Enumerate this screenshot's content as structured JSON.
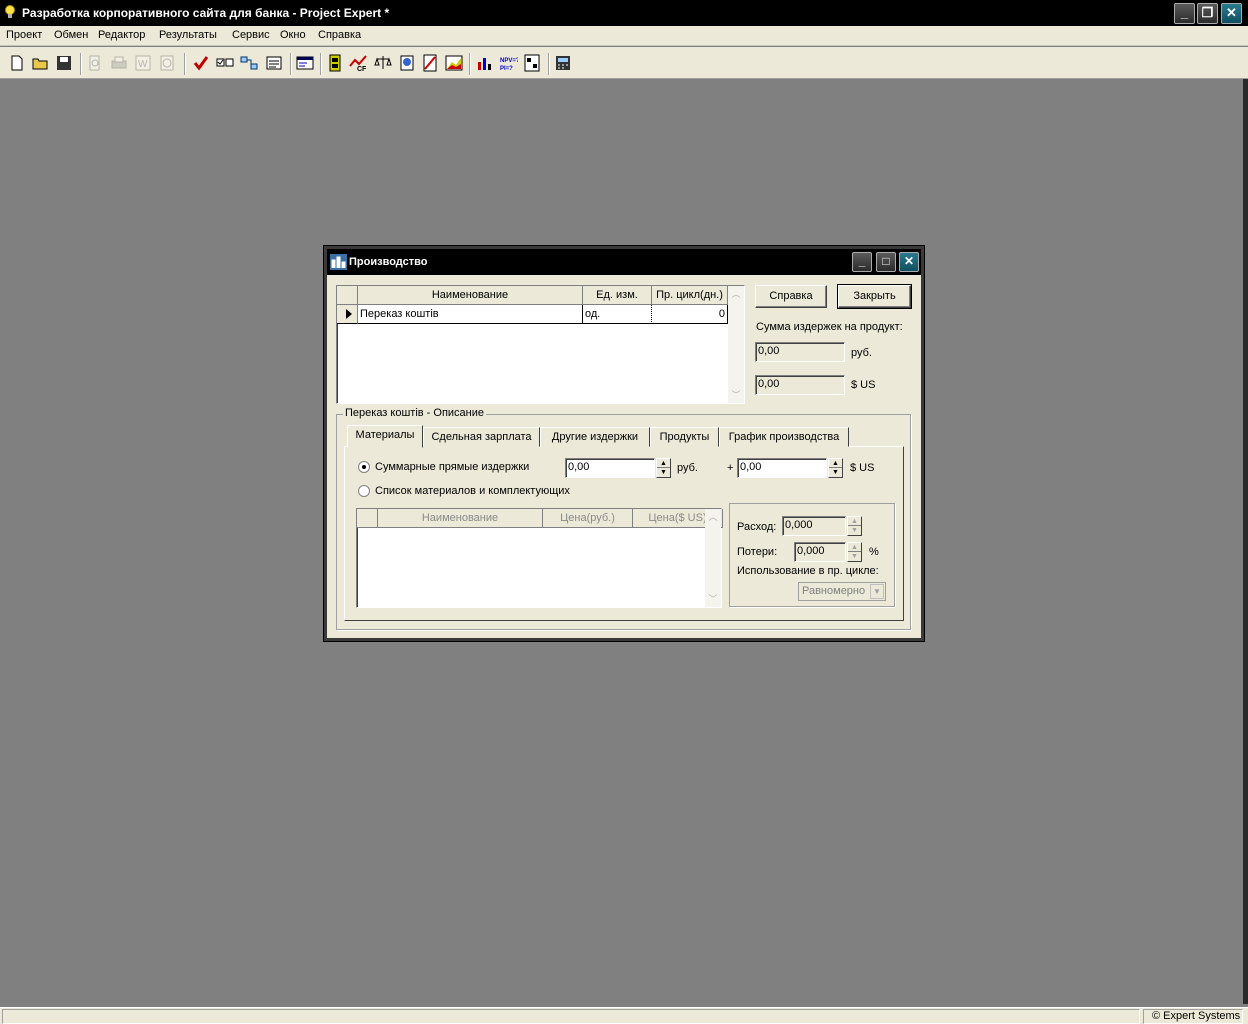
{
  "app": {
    "title": "Разработка корпоративного сайта для банка - Project Expert *",
    "menu": [
      "Проект",
      "Обмен",
      "Редактор",
      "Результаты",
      "Сервис",
      "Окно",
      "Справка"
    ]
  },
  "status": {
    "copyright": "© Expert Systems"
  },
  "dialog": {
    "title": "Производство",
    "products_table": {
      "columns": [
        "Наименование",
        "Ед. изм.",
        "Пр. цикл(дн.)"
      ],
      "rows": [
        {
          "name": "Переказ коштів",
          "unit": "од.",
          "cycle": "0"
        }
      ]
    },
    "buttons": {
      "help": "Справка",
      "close": "Закрыть"
    },
    "cost_sum_label": "Сумма издержек на продукт:",
    "cost_rub": "0,00",
    "rub_unit": "руб.",
    "cost_usd": "0,00",
    "usd_unit": "$ US",
    "desc_group": "Переказ коштів - Описание",
    "tabs": [
      "Материалы",
      "Сдельная зарплата",
      "Другие издержки",
      "Продукты",
      "График производства"
    ],
    "materials": {
      "radio_total": "Суммарные прямые издержки",
      "total_rub": "0,00",
      "rub_unit": "руб.",
      "plus": "+",
      "total_usd": "0,00",
      "usd_unit": "$ US",
      "radio_list": "Список материалов и комплектующих",
      "list_columns": [
        "Наименование",
        "Цена(руб.)",
        "Цена($ US)"
      ],
      "consumption_label": "Расход:",
      "consumption_value": "0,000",
      "losses_label": "Потери:",
      "losses_value": "0,000",
      "percent": "%",
      "usage_label": "Использование в пр. цикле:",
      "usage_value": "Равномерно"
    }
  }
}
